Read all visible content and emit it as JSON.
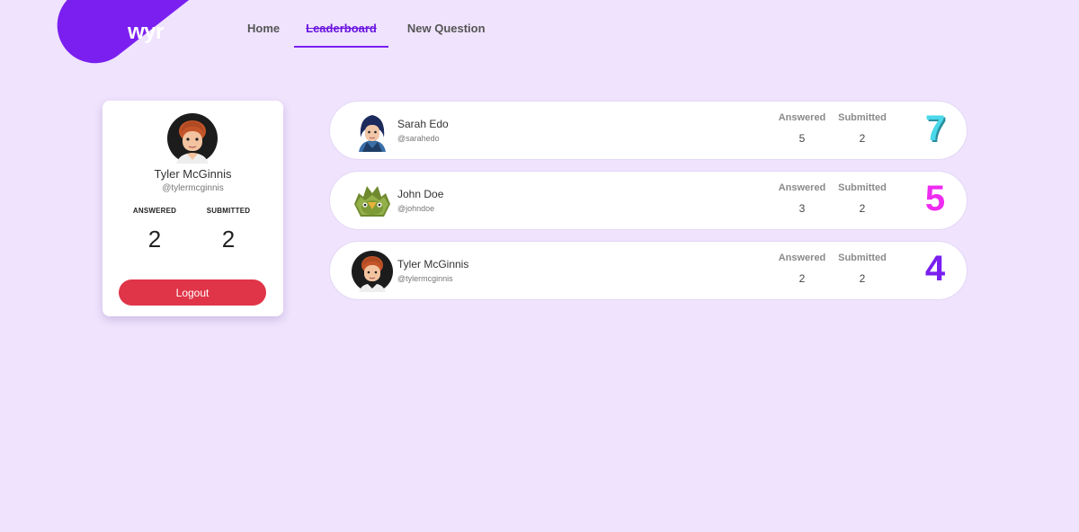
{
  "header": {
    "logo_text": "wyr",
    "nav": [
      {
        "label": "Home",
        "active": false
      },
      {
        "label": "Leaderboard",
        "active": true
      },
      {
        "label": "New Question",
        "active": false
      }
    ]
  },
  "profile": {
    "name": "Tyler McGinnis",
    "handle": "@tylermcginnis",
    "answered_label": "ANSWERED",
    "submitted_label": "SUBMITTED",
    "answered": "2",
    "submitted": "2",
    "logout_label": "Logout"
  },
  "leaderboard": {
    "answered_label": "Answered",
    "submitted_label": "Submitted",
    "rows": [
      {
        "name": "Sarah Edo",
        "handle": "@sarahedo",
        "answered": "5",
        "submitted": "2",
        "score": "7",
        "score_color": "#4ad8ea",
        "avatar": "sarah-avatar"
      },
      {
        "name": "John Doe",
        "handle": "@johndoe",
        "answered": "3",
        "submitted": "2",
        "score": "5",
        "score_color": "#ee2bf0",
        "avatar": "john-avatar"
      },
      {
        "name": "Tyler McGinnis",
        "handle": "@tylermcginnis",
        "answered": "2",
        "submitted": "2",
        "score": "4",
        "score_color": "#7a1ff0",
        "avatar": "tyler-avatar"
      }
    ]
  },
  "colors": {
    "background": "#efe3fd",
    "accent": "#7a1ff0",
    "logout": "#e03548"
  }
}
